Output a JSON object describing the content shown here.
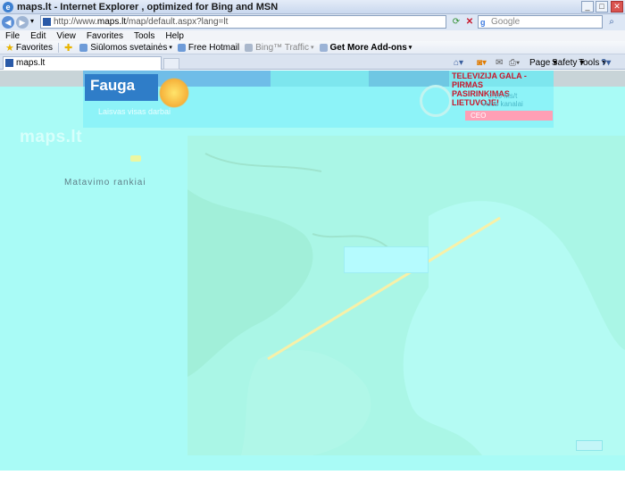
{
  "window": {
    "title": "maps.lt - Internet Explorer , optimized for Bing and MSN",
    "minimize": "_",
    "maximize": "□",
    "close": "✕"
  },
  "address_bar": {
    "url_prefix": "http://www.",
    "url_host": "maps.lt",
    "url_path": "/map/default.aspx?lang=lt",
    "search_placeholder": "Google",
    "search_engine_letter": "g"
  },
  "menu": [
    "File",
    "Edit",
    "View",
    "Favorites",
    "Tools",
    "Help"
  ],
  "favorites_bar": {
    "favorites_label": "Favorites",
    "items": [
      "Siūlomos svetainės",
      "Free Hotmail",
      "Bing™ Traffic",
      "Get More Add-ons"
    ]
  },
  "tabs": [
    {
      "label": "maps.lt"
    }
  ],
  "command_bar": {
    "page": "Page",
    "safety": "Safety",
    "tools": "Tools",
    "help_icon": "?"
  },
  "banner": {
    "brand": "Fauga",
    "tagline": "Laisvas   visas   darbai",
    "right_headline_1": "TELEVIZIJA GALA - PIRMAS",
    "right_headline_2": "PASIRINKIMAS LIETUVOJE!",
    "info_line_1": "0,15 Ms/t",
    "info_line_2": "visos kanalai",
    "cta": "CEO"
  },
  "site": {
    "logo": "maps.lt",
    "sidebar_title": "Matavimo rankiai"
  },
  "bottom_bar": {
    "pill_label": "↔"
  }
}
